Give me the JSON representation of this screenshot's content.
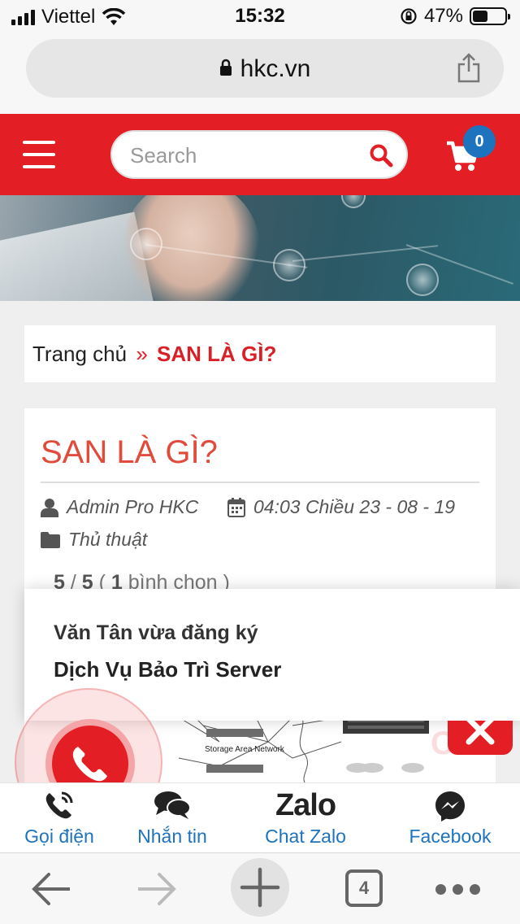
{
  "status_bar": {
    "carrier": "Viettel",
    "time": "15:32",
    "battery_percent": "47%",
    "battery_level": 0.47
  },
  "url_bar": {
    "domain": "hkc.vn"
  },
  "header": {
    "search_placeholder": "Search",
    "cart_count": "0",
    "accent_color": "#e31e24",
    "badge_color": "#1e73be"
  },
  "breadcrumb": {
    "home": "Trang chủ",
    "separator": "»",
    "current": "SAN LÀ GÌ?"
  },
  "article": {
    "title": "SAN LÀ GÌ?",
    "author": "Admin Pro HKC",
    "datetime": "04:03 Chiều 23 - 08 - 19",
    "category": "Thủ thuật",
    "rating": {
      "score": "5",
      "max": "5",
      "votes": "1",
      "votes_label": "bình chọn"
    },
    "diagram_label": "Storage Area Network"
  },
  "popup": {
    "line1": "Văn Tân vừa đăng ký",
    "line2": "Dịch Vụ Bảo Trì Server"
  },
  "contact_bar": {
    "call_label": "Gọi điện",
    "message_label": "Nhắn tin",
    "zalo_logo": "Zalo",
    "zalo_label": "Chat Zalo",
    "facebook_label": "Facebook"
  },
  "toolbar": {
    "tab_count": "4"
  }
}
